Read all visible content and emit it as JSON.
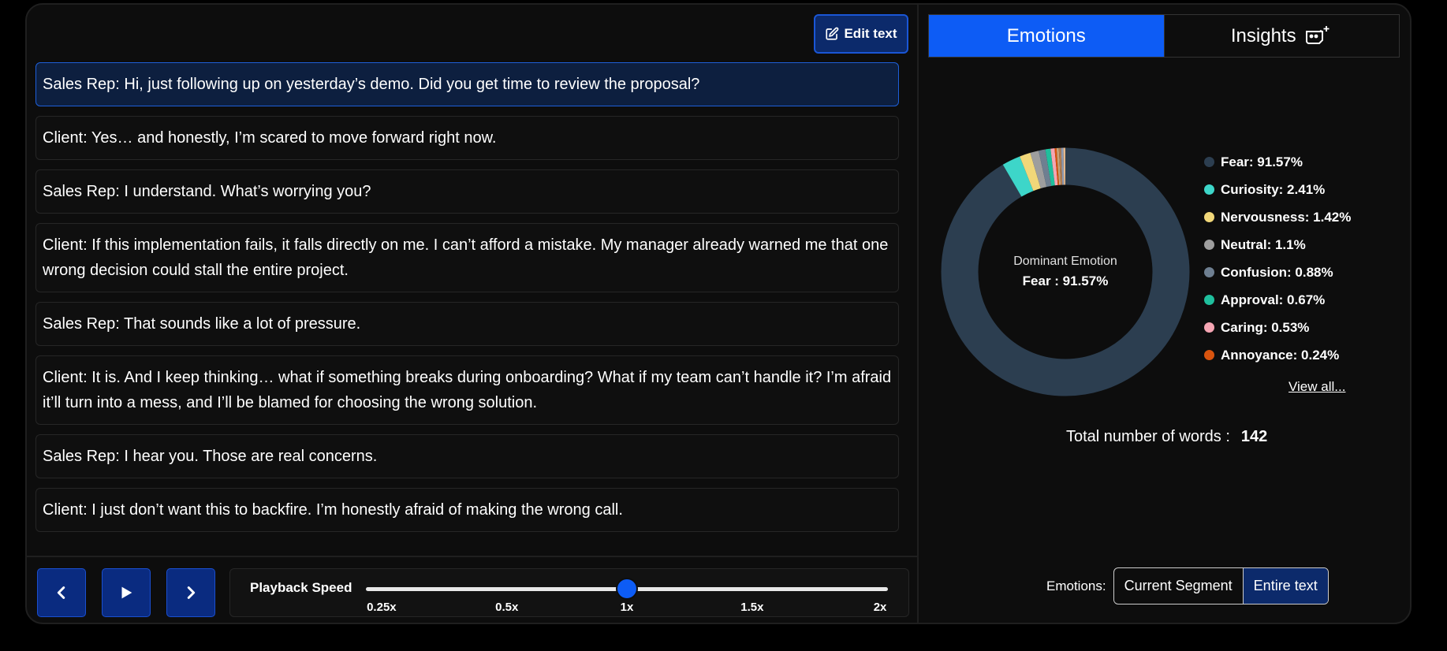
{
  "edit_button": {
    "label": "Edit text",
    "icon": "edit-icon"
  },
  "transcript": [
    {
      "text": "Sales Rep: Hi, just following up on yesterday’s demo. Did you get time to review the proposal?",
      "active": true
    },
    {
      "text": "Client: Yes… and honestly, I’m scared to move forward right now.",
      "active": false
    },
    {
      "text": "Sales Rep: I understand. What’s worrying you?",
      "active": false
    },
    {
      "text": "Client: If this implementation fails, it falls directly on me. I can’t afford a mistake. My manager already warned me that one wrong decision could stall the entire project.",
      "active": false
    },
    {
      "text": "Sales Rep: That sounds like a lot of pressure.",
      "active": false
    },
    {
      "text": "Client: It is. And I keep thinking… what if something breaks during onboarding? What if my team can’t handle it? I’m afraid it’ll turn into a mess, and I’ll be blamed for choosing the wrong solution.",
      "active": false
    },
    {
      "text": "Sales Rep: I hear you. Those are real concerns.",
      "active": false
    },
    {
      "text": "Client: I just don’t want this to backfire. I’m honestly afraid of making the wrong call.",
      "active": false
    }
  ],
  "playback": {
    "label": "Playback Speed",
    "ticks": [
      "0.25x",
      "0.5x",
      "1x",
      "1.5x",
      "2x"
    ],
    "selected_index": 2,
    "prev_icon": "chevron-left-icon",
    "play_icon": "play-icon",
    "next_icon": "chevron-right-icon"
  },
  "tabs": [
    {
      "label": "Emotions",
      "active": true
    },
    {
      "label": "Insights",
      "active": false,
      "icon": "ai-sparkle-icon"
    }
  ],
  "donut": {
    "center_label": "Dominant Emotion",
    "center_value": "Fear : 91.57%"
  },
  "chart_data": {
    "type": "pie",
    "categories": [
      "Fear",
      "Curiosity",
      "Nervousness",
      "Neutral",
      "Confusion",
      "Approval",
      "Caring",
      "Annoyance"
    ],
    "values": [
      91.57,
      2.41,
      1.42,
      1.1,
      0.88,
      0.67,
      0.53,
      0.24
    ],
    "colors": [
      "#2c3e50",
      "#3dd6c9",
      "#f1d779",
      "#9e9e9e",
      "#6e7f91",
      "#1fbf9d",
      "#f5a5b3",
      "#d9540e"
    ],
    "remainder_colors": [
      "#c8a27a",
      "#b07c4f",
      "#8f9bb3",
      "#e6b88a"
    ],
    "title": "",
    "legend_position": "right"
  },
  "legend": [
    {
      "label": "Fear: 91.57%",
      "color": "#2c3e50"
    },
    {
      "label": "Curiosity: 2.41%",
      "color": "#3dd6c9"
    },
    {
      "label": "Nervousness: 1.42%",
      "color": "#f1d779"
    },
    {
      "label": "Neutral: 1.1%",
      "color": "#9e9e9e"
    },
    {
      "label": "Confusion: 0.88%",
      "color": "#6e7f91"
    },
    {
      "label": "Approval: 0.67%",
      "color": "#1fbf9d"
    },
    {
      "label": "Caring: 0.53%",
      "color": "#f5a5b3"
    },
    {
      "label": "Annoyance: 0.24%",
      "color": "#d9540e"
    }
  ],
  "view_all": "View all...",
  "total_words": {
    "label": "Total number of words :",
    "value": "142"
  },
  "emotions_scope": {
    "label": "Emotions:",
    "options": [
      "Current Segment",
      "Entire text"
    ],
    "selected": "Entire text"
  },
  "colors": {
    "accent": "#0d5cf5",
    "button_bg": "#0a2b80",
    "panel_bg": "#0d0d0d"
  }
}
